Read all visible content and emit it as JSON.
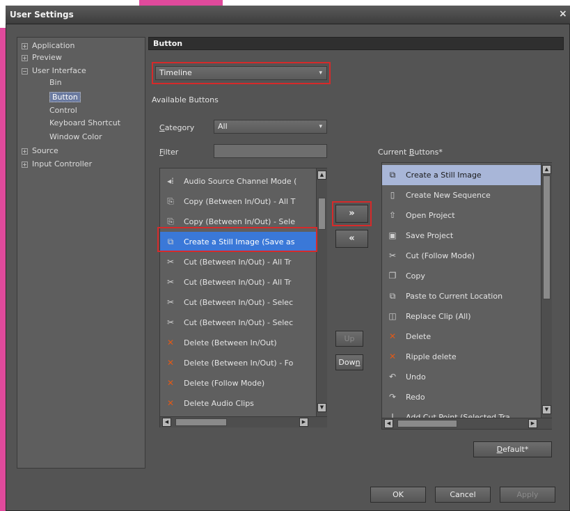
{
  "window": {
    "title": "User Settings",
    "close_glyph": "×"
  },
  "tree": [
    {
      "label": "Application",
      "expander": "+"
    },
    {
      "label": "Preview",
      "expander": "+"
    },
    {
      "label": "User Interface",
      "expander": "−"
    },
    {
      "label": "Bin"
    },
    {
      "label": "Button",
      "selected": true
    },
    {
      "label": "Control"
    },
    {
      "label": "Keyboard Shortcut"
    },
    {
      "label": "Window Color"
    },
    {
      "label": "Source",
      "expander": "+"
    },
    {
      "label": "Input Controller",
      "expander": "+"
    }
  ],
  "section": {
    "title": "Button"
  },
  "timeline_select": {
    "value": "Timeline",
    "arrow": "▾"
  },
  "available_label": "Available Buttons",
  "category": {
    "label_first": "C",
    "label_rest": "ategory",
    "value": "All",
    "arrow": "▾"
  },
  "filter": {
    "label_first": "F",
    "label_rest": "ilter",
    "value": ""
  },
  "current_label": {
    "prefix": "Current ",
    "u": "B",
    "rest": "uttons*"
  },
  "available_buttons": [
    {
      "icon": "speaker-icon",
      "glyph": "◂⁞",
      "label": "Audio Source Channel Mode ("
    },
    {
      "icon": "copy-inout-all-icon",
      "glyph": "⎘",
      "label": "Copy (Between In/Out) - All T"
    },
    {
      "icon": "copy-inout-sel-icon",
      "glyph": "⎘",
      "label": "Copy (Between In/Out) - Sele"
    },
    {
      "icon": "still-image-icon",
      "glyph": "⧉",
      "label": "Create a Still Image (Save as",
      "selected": true
    },
    {
      "icon": "cut-inout-all-icon",
      "glyph": "✂",
      "label": "Cut (Between In/Out) - All Tr"
    },
    {
      "icon": "cut-inout-all2-icon",
      "glyph": "✂",
      "label": "Cut (Between In/Out) - All Tr"
    },
    {
      "icon": "cut-inout-sel-icon",
      "glyph": "✂",
      "label": "Cut (Between In/Out) - Selec"
    },
    {
      "icon": "cut-inout-sel2-icon",
      "glyph": "✂",
      "label": "Cut (Between In/Out) - Selec"
    },
    {
      "icon": "delete-inout-icon",
      "glyph": "✕",
      "label": "Delete (Between In/Out)",
      "red": true
    },
    {
      "icon": "delete-inout-fo-icon",
      "glyph": "✕",
      "label": "Delete (Between In/Out) - Fo",
      "red": true
    },
    {
      "icon": "delete-follow-icon",
      "glyph": "✕",
      "label": "Delete (Follow Mode)",
      "red": true
    },
    {
      "icon": "delete-audio-icon",
      "glyph": "✕",
      "label": "Delete Audio Clips",
      "red": true
    }
  ],
  "current_buttons": [
    {
      "icon": "still-image-icon",
      "glyph": "⧉",
      "label": "Create a Still Image",
      "highlighted": true
    },
    {
      "icon": "new-sequence-icon",
      "glyph": "▯",
      "label": "Create New Sequence"
    },
    {
      "icon": "open-project-icon",
      "glyph": "⇧",
      "label": "Open Project"
    },
    {
      "icon": "save-project-icon",
      "glyph": "▣",
      "label": "Save Project"
    },
    {
      "icon": "cut-icon",
      "glyph": "✂",
      "label": "Cut (Follow Mode)"
    },
    {
      "icon": "copy-icon",
      "glyph": "❐",
      "label": "Copy"
    },
    {
      "icon": "paste-icon",
      "glyph": "⧉",
      "label": "Paste to Current Location"
    },
    {
      "icon": "replace-clip-icon",
      "glyph": "◫",
      "label": "Replace Clip (All)"
    },
    {
      "icon": "delete-icon",
      "glyph": "✕",
      "label": "Delete",
      "red": true
    },
    {
      "icon": "ripple-delete-icon",
      "glyph": "✕",
      "label": "Ripple delete",
      "red": true
    },
    {
      "icon": "undo-icon",
      "glyph": "↶",
      "label": "Undo"
    },
    {
      "icon": "redo-icon",
      "glyph": "↷",
      "label": "Redo"
    },
    {
      "icon": "add-cut-point-icon",
      "glyph": "ǀ",
      "label": "Add Cut Point (Selected Tra"
    }
  ],
  "buttons": {
    "add": "»",
    "remove": "«",
    "up": "Up",
    "down_first": "Dow",
    "down_u": "n",
    "default_u": "D",
    "default_rest": "efault*",
    "ok": "OK",
    "cancel": "Cancel",
    "apply": "Apply"
  },
  "colors": {
    "highlight_red": "#d62a2a",
    "selection_blue": "#3a78d8",
    "accent_pink": "#e04a9c"
  }
}
